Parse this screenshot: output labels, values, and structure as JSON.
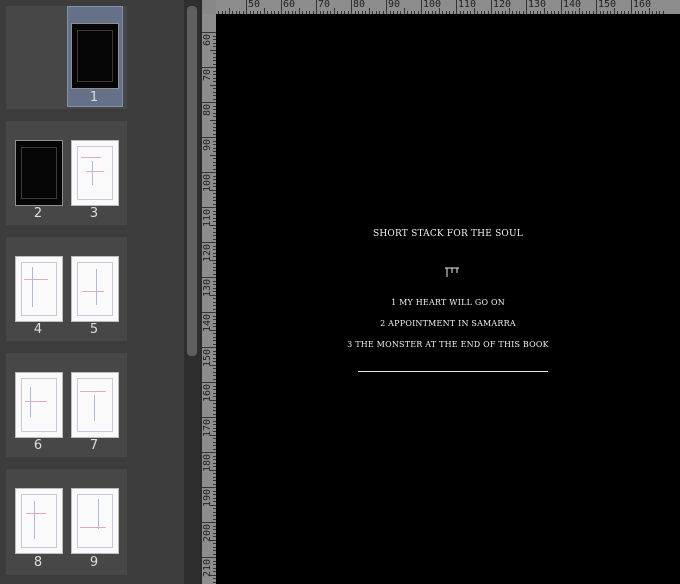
{
  "thumbnails": {
    "pages": [
      {
        "number": "1",
        "style": "dark"
      },
      {
        "number": "2",
        "style": "dark"
      },
      {
        "number": "3",
        "style": "sketch"
      },
      {
        "number": "4",
        "style": "sketch"
      },
      {
        "number": "5",
        "style": "sketch"
      },
      {
        "number": "6",
        "style": "sketch"
      },
      {
        "number": "7",
        "style": "sketch"
      },
      {
        "number": "8",
        "style": "sketch"
      },
      {
        "number": "9",
        "style": "sketch"
      }
    ],
    "selected_page": "1"
  },
  "ruler": {
    "horizontal_labels": [
      "50",
      "60",
      "70",
      "80",
      "90",
      "100",
      "110",
      "120",
      "130",
      "140",
      "150",
      "160"
    ],
    "vertical_labels": [
      "60",
      "70",
      "80",
      "90",
      "100",
      "110",
      "120",
      "130",
      "140",
      "150",
      "160",
      "170",
      "180",
      "190",
      "200",
      "210"
    ]
  },
  "canvas": {
    "title": "SHORT STACK FOR THE SOUL",
    "toc": [
      "1 MY HEART WILL GO ON",
      "2 APPOINTMENT IN SAMARRA",
      "3 THE MONSTER AT THE END OF THIS BOOK"
    ]
  },
  "colors": {
    "canvas_bg": "#000000",
    "panel_bg": "#3c3c3c",
    "selected_highlight": "#657089",
    "sketch_pink": "#e6a6c4",
    "sketch_blue": "#a9b9e8"
  }
}
